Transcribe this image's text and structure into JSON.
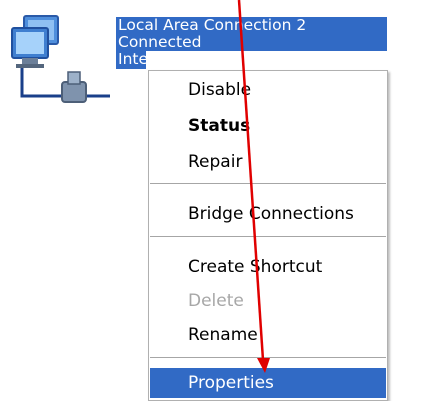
{
  "connection": {
    "name": "Local Area Connection 2",
    "status": "Connected",
    "device_partial": "Inte",
    "icon": "network-connection-icon"
  },
  "context_menu": {
    "items": [
      {
        "label": "Disable",
        "bold": false,
        "disabled": false
      },
      {
        "label": "Status",
        "bold": true,
        "disabled": false
      },
      {
        "label": "Repair",
        "bold": false,
        "disabled": false
      },
      {
        "label": "Bridge Connections",
        "bold": false,
        "disabled": false
      },
      {
        "label": "Create Shortcut",
        "bold": false,
        "disabled": false
      },
      {
        "label": "Delete",
        "bold": false,
        "disabled": true
      },
      {
        "label": "Rename",
        "bold": false,
        "disabled": false
      },
      {
        "label": "Properties",
        "bold": false,
        "disabled": false,
        "selected": true
      }
    ]
  },
  "annotation": {
    "arrow_color": "#e00000",
    "points_to": "Properties"
  },
  "colors": {
    "selection": "#316ac5",
    "disabled_text": "#a7a7a7"
  }
}
